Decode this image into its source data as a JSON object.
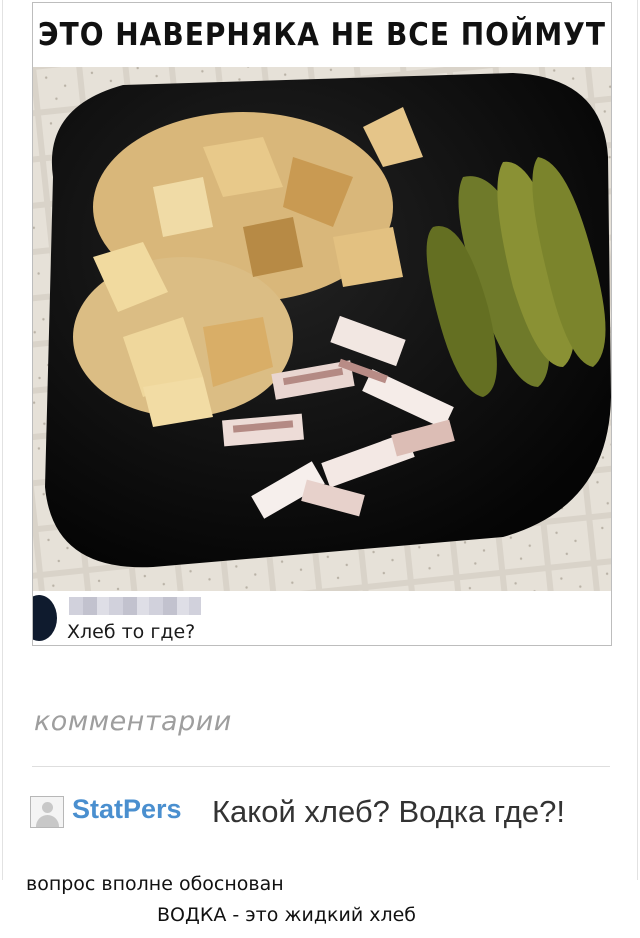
{
  "meme": {
    "caption": "ЭТО НАВЕРНЯКА НЕ ВСЕ ПОЙМУТ",
    "photo_description": "plate-with-potatoes-salo-pickles",
    "inner_comment": "Хлеб то где?"
  },
  "comments": {
    "label": "комментарии",
    "items": [
      {
        "username": "StatPers",
        "text": "Какой хлеб? Водка где?!"
      }
    ]
  },
  "footer": {
    "line1": "вопрос вполне обоснован",
    "line2": "ВОДКА - это жидкий хлеб"
  },
  "colors": {
    "username": "#4a8fcf",
    "label": "#9e9e9e",
    "plate": "#0b0b0b"
  }
}
